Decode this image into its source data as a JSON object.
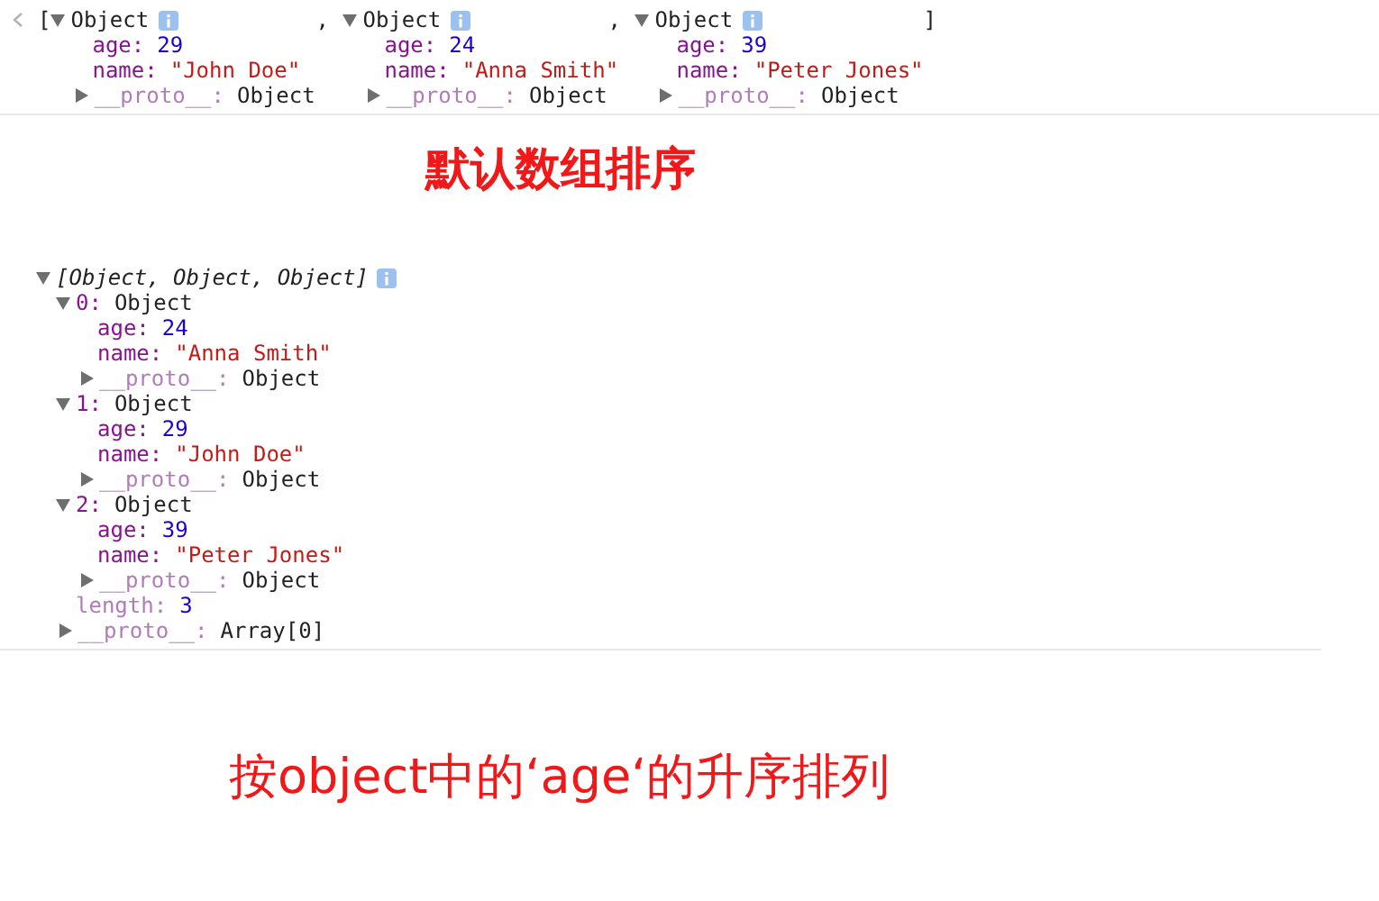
{
  "log_line": {
    "open_bracket": "[",
    "close_bracket": "]",
    "separators": [
      ",",
      ","
    ],
    "objects": [
      {
        "label": "Object",
        "expanded": true,
        "properties": [
          {
            "key": "age:",
            "value": "29",
            "kind": "number"
          },
          {
            "key": "name:",
            "value": "\"John Doe\"",
            "kind": "string"
          }
        ],
        "proto": {
          "key": "__proto__:",
          "value": "Object",
          "expanded": false
        }
      },
      {
        "label": "Object",
        "expanded": true,
        "properties": [
          {
            "key": "age:",
            "value": "24",
            "kind": "number"
          },
          {
            "key": "name:",
            "value": "\"Anna Smith\"",
            "kind": "string"
          }
        ],
        "proto": {
          "key": "__proto__:",
          "value": "Object",
          "expanded": false
        }
      },
      {
        "label": "Object",
        "expanded": true,
        "properties": [
          {
            "key": "age:",
            "value": "39",
            "kind": "number"
          },
          {
            "key": "name:",
            "value": "\"Peter Jones\"",
            "kind": "string"
          }
        ],
        "proto": {
          "key": "__proto__:",
          "value": "Object",
          "expanded": false
        }
      }
    ]
  },
  "caption_1": "默认数组排序",
  "array_tree": {
    "summary": "[Object, Object, Object]",
    "expanded": true,
    "items": [
      {
        "index": "0:",
        "label": "Object",
        "expanded": true,
        "properties": [
          {
            "key": "age:",
            "value": "24",
            "kind": "number"
          },
          {
            "key": "name:",
            "value": "\"Anna Smith\"",
            "kind": "string"
          }
        ],
        "proto": {
          "key": "__proto__:",
          "value": "Object",
          "expanded": false
        }
      },
      {
        "index": "1:",
        "label": "Object",
        "expanded": true,
        "properties": [
          {
            "key": "age:",
            "value": "29",
            "kind": "number"
          },
          {
            "key": "name:",
            "value": "\"John Doe\"",
            "kind": "string"
          }
        ],
        "proto": {
          "key": "__proto__:",
          "value": "Object",
          "expanded": false
        }
      },
      {
        "index": "2:",
        "label": "Object",
        "expanded": true,
        "properties": [
          {
            "key": "age:",
            "value": "39",
            "kind": "number"
          },
          {
            "key": "name:",
            "value": "\"Peter Jones\"",
            "kind": "string"
          }
        ],
        "proto": {
          "key": "__proto__:",
          "value": "Object",
          "expanded": false
        }
      }
    ],
    "length": {
      "key": "length:",
      "value": "3",
      "kind": "number"
    },
    "proto": {
      "key": "__proto__:",
      "value": "Array[0]",
      "expanded": false
    }
  },
  "caption_2": "按object中的‘age‘的升序排列"
}
